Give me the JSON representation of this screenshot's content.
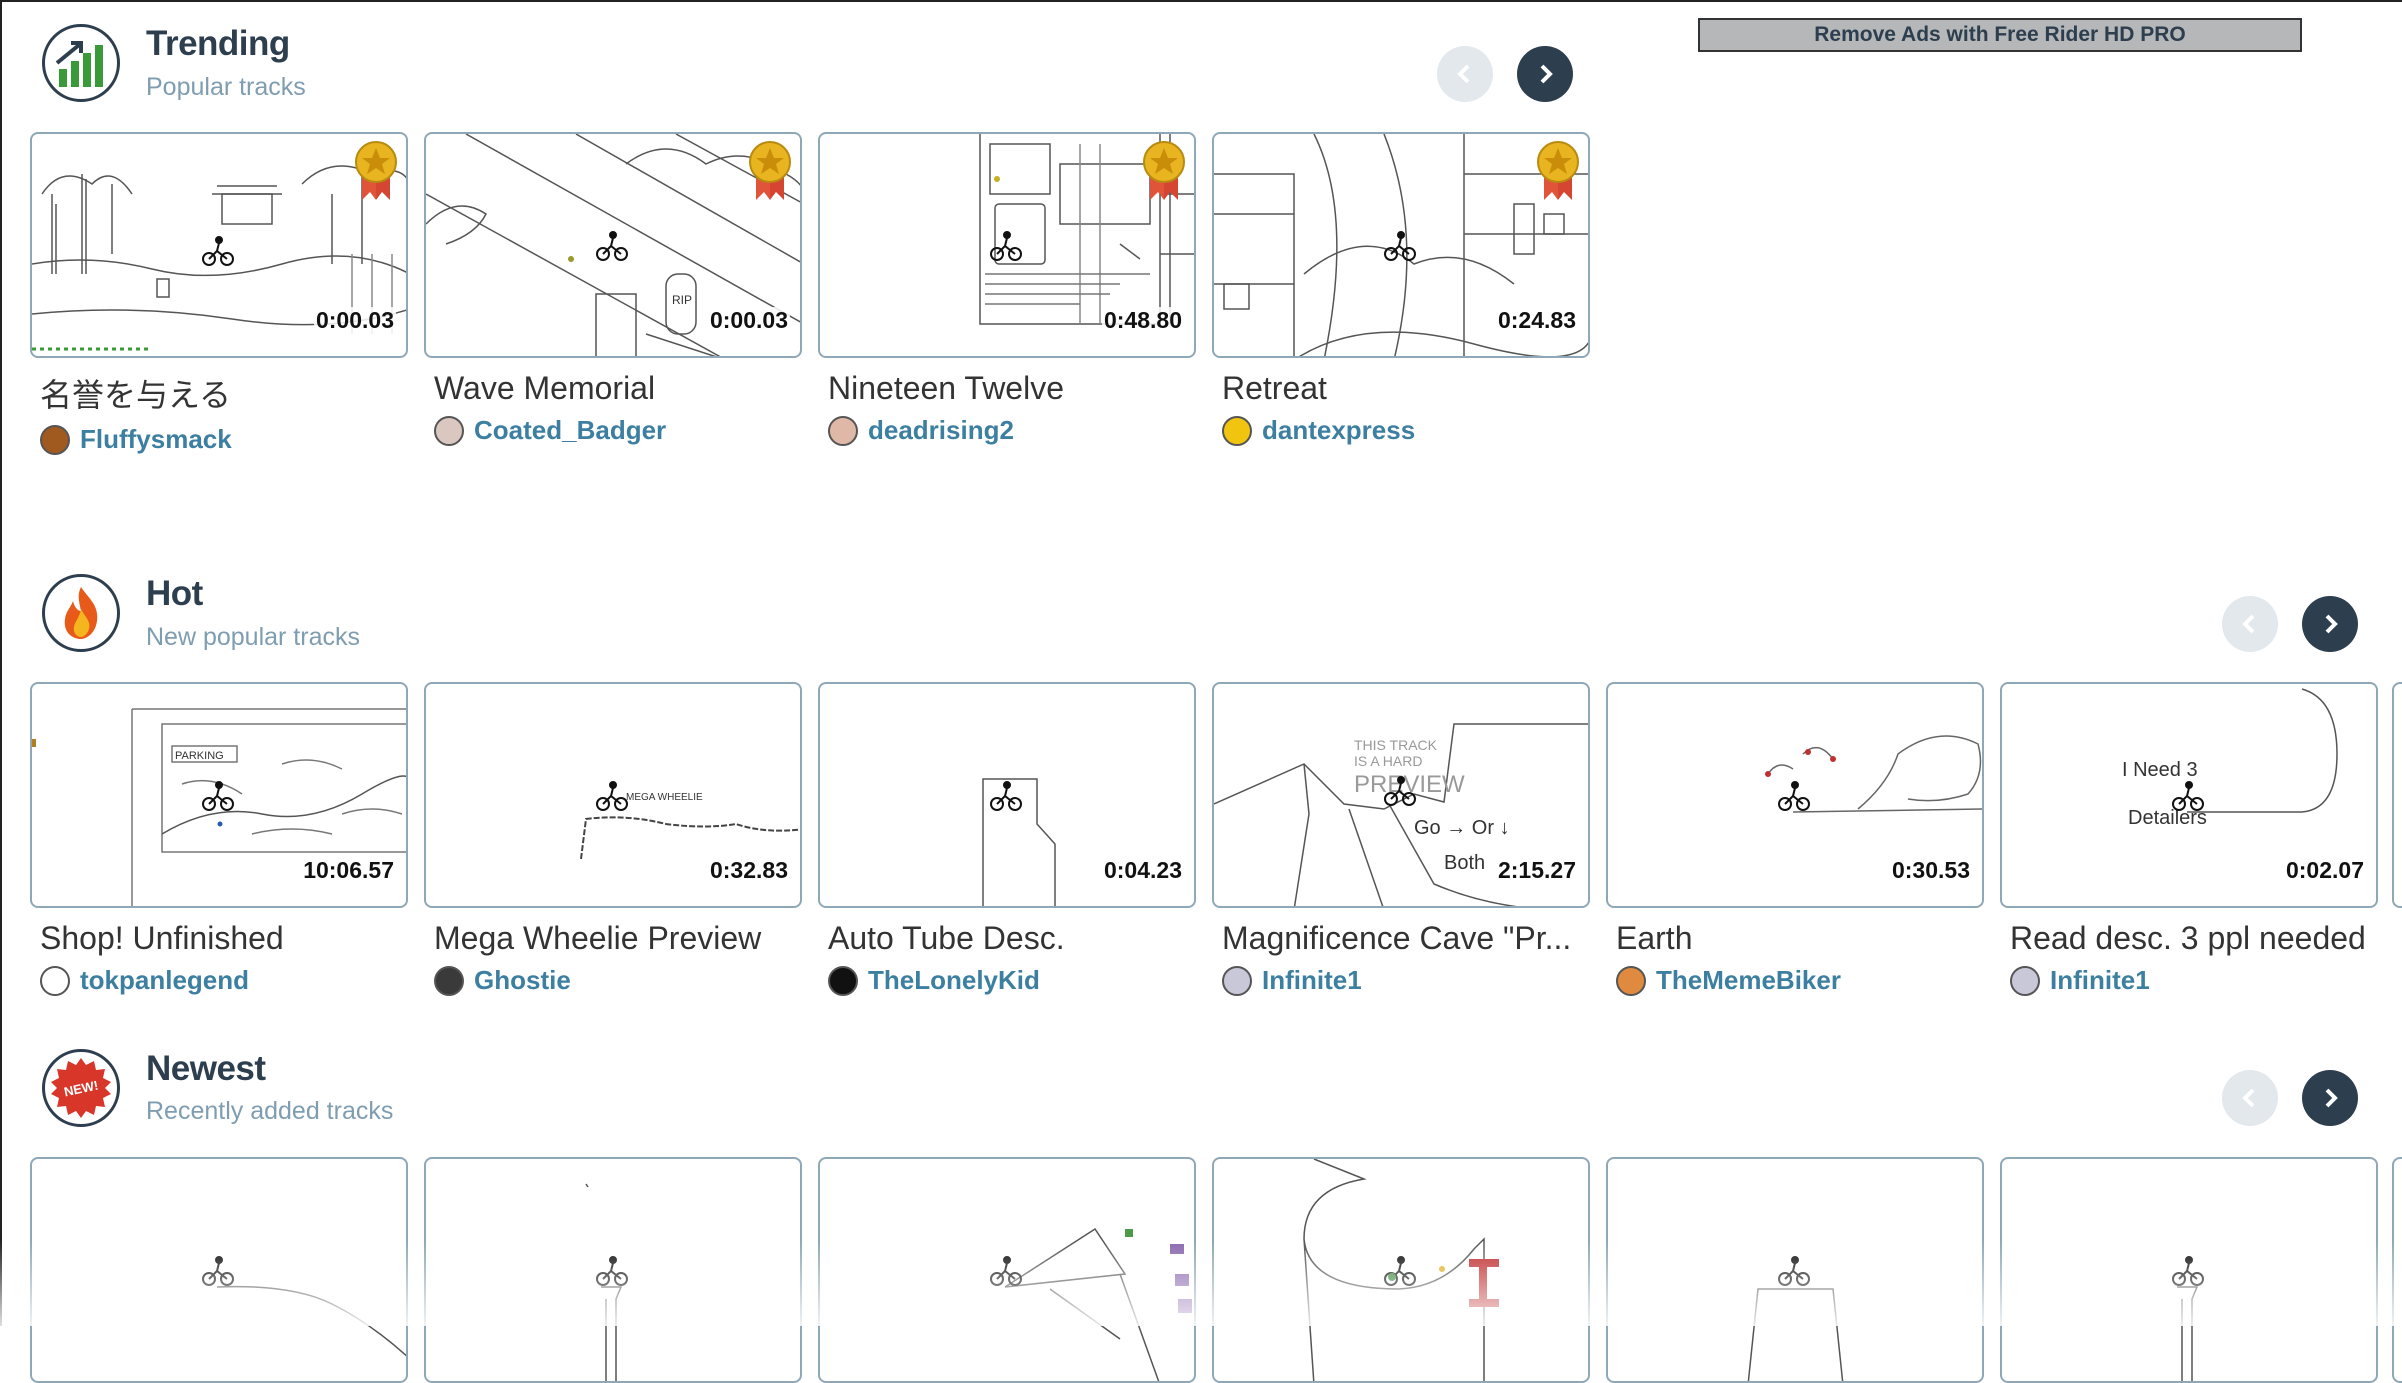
{
  "pro_banner": "Remove Ads with Free Rider HD PRO",
  "sections": {
    "trending": {
      "title": "Trending",
      "subtitle": "Popular tracks",
      "icon": "trending-chart-icon",
      "tracks": [
        {
          "title": "名誉を与える",
          "time": "0:00.03",
          "author": "Fluffysmack",
          "featured": true
        },
        {
          "title": "Wave Memorial",
          "time": "0:00.03",
          "author": "Coated_Badger",
          "featured": true
        },
        {
          "title": "Nineteen Twelve",
          "time": "0:48.80",
          "author": "deadrising2",
          "featured": true
        },
        {
          "title": "Retreat",
          "time": "0:24.83",
          "author": "dantexpress",
          "featured": true
        }
      ]
    },
    "hot": {
      "title": "Hot",
      "subtitle": "New popular tracks",
      "icon": "flame-icon",
      "tracks": [
        {
          "title": "Shop! Unfinished",
          "time": "10:06.57",
          "author": "tokpanlegend"
        },
        {
          "title": "Mega Wheelie Preview",
          "time": "0:32.83",
          "author": "Ghostie"
        },
        {
          "title": "Auto Tube Desc.",
          "time": "0:04.23",
          "author": "TheLonelyKid"
        },
        {
          "title": "Magnificence Cave \"Pr...",
          "time": "2:15.27",
          "author": "Infinite1"
        },
        {
          "title": "Earth",
          "time": "0:30.53",
          "author": "TheMemeBiker"
        },
        {
          "title": "Read desc. 3 ppl needed",
          "time": "0:02.07",
          "author": "Infinite1"
        }
      ]
    },
    "newest": {
      "title": "Newest",
      "subtitle": "Recently added tracks",
      "icon": "new-badge-icon",
      "badge_text": "NEW!"
    }
  },
  "thumb_texts": {
    "parking": "PARKING",
    "mega": "MEGA WHEELIE",
    "hard1": "THIS TRACK",
    "hard2": "IS A HARD",
    "hard3": "PREVIEW",
    "go": "Go → Or ↓",
    "both": "Both",
    "ineed": "I Need 3",
    "detailers": "Detailers",
    "rip": "RIP"
  },
  "colors": {
    "brand_dark": "#2d3e4e",
    "link": "#3d7fa1",
    "subtitle": "#7f9db1",
    "card_border": "#8ea8b8"
  }
}
